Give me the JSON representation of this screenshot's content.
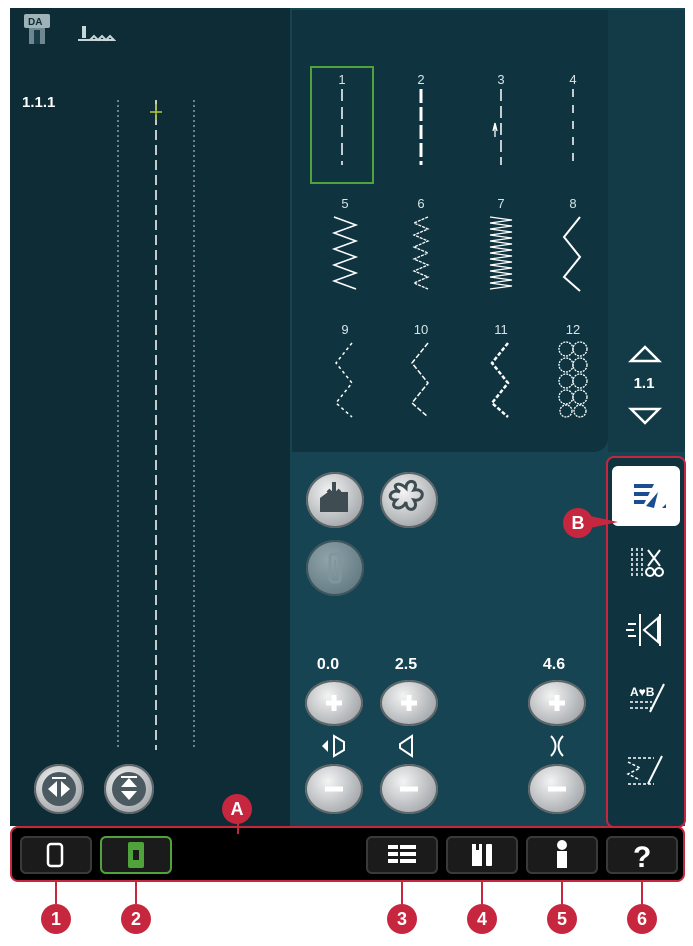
{
  "stitch_preview": {
    "stitch_number": "1.1.1",
    "icons": [
      "presser-foot-icon",
      "feed-dog-icon"
    ]
  },
  "stitch_menu": {
    "page": "1.1",
    "stitches": [
      "1",
      "2",
      "3",
      "4",
      "5",
      "6",
      "7",
      "8",
      "9",
      "10",
      "11",
      "12"
    ],
    "selected": "1"
  },
  "controls": {
    "stitch_position": "0.0",
    "stitch_length": "2.5",
    "thread_tension": "4.6"
  },
  "markers": {
    "A": "A",
    "B": "B",
    "n1": "1",
    "n2": "2",
    "n3": "3",
    "n4": "4",
    "n5": "5",
    "n6": "6"
  },
  "colors": {
    "marker": "#c6273f",
    "selected_tab": "#4fa33a",
    "highlight_outline": "#c6273f"
  }
}
